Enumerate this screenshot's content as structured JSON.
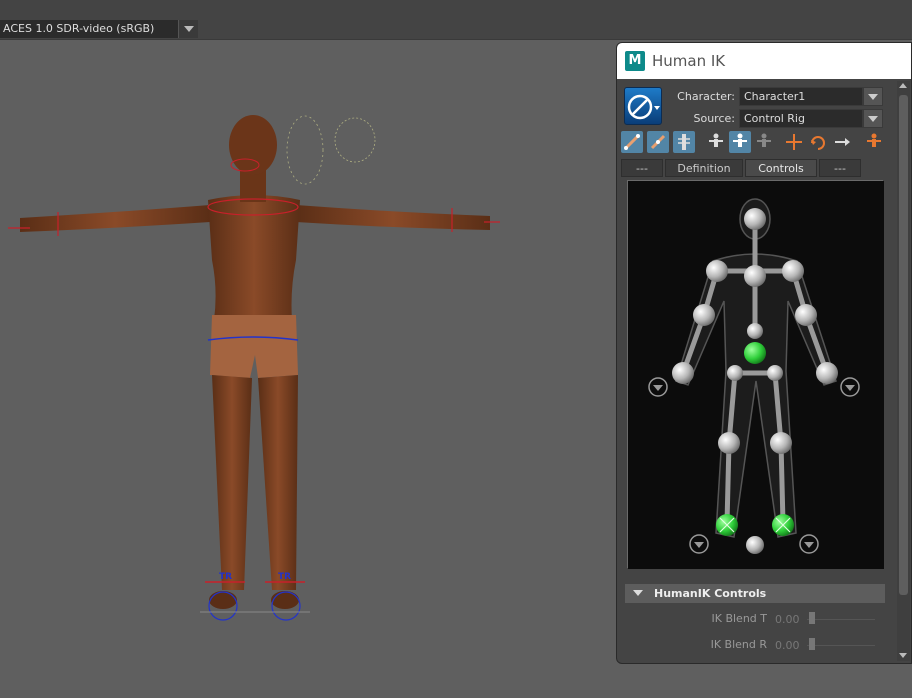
{
  "viewport": {
    "color_space": "ACES 1.0 SDR-video (sRGB)",
    "dropdown_icon": "chevron-down-icon",
    "body_rig_label_left": "TR",
    "body_rig_label_right": "TR"
  },
  "human_ik": {
    "title": "Human IK",
    "app_icon_letter": "M",
    "character_label": "Character:",
    "character_value": "Character1",
    "source_label": "Source:",
    "source_value": "Control Rig",
    "tabs": [
      {
        "label": "---"
      },
      {
        "label": "Definition"
      },
      {
        "label": "Controls"
      },
      {
        "label": "---"
      }
    ],
    "active_tab": "Controls",
    "section_title": "HumanIK Controls",
    "ik_blend_t_label": "IK Blend T",
    "ik_blend_t_value": "0.00",
    "ik_blend_r_label": "IK Blend R",
    "ik_blend_r_value": "0.00",
    "colors": {
      "active_tool": "#5285a6",
      "effector_green": "#2fcf3a",
      "panel_bg": "#444444"
    }
  }
}
